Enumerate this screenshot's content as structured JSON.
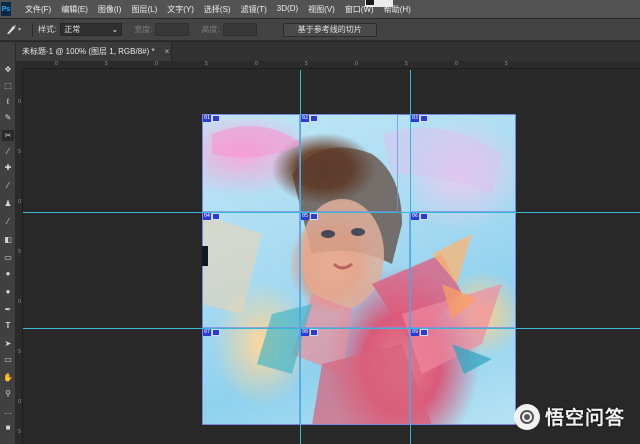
{
  "app": {
    "logo": "Ps"
  },
  "menu": {
    "items": [
      "文件(F)",
      "编辑(E)",
      "图像(I)",
      "图层(L)",
      "文字(Y)",
      "选择(S)",
      "滤镜(T)",
      "3D(D)",
      "视图(V)",
      "窗口(W)",
      "帮助(H)"
    ]
  },
  "options": {
    "tool_icon": "slice-tool-icon",
    "style_label": "样式:",
    "style_value": "正常",
    "width_label": "宽度:",
    "height_label": "高度:",
    "guides_button": "基于参考线的切片"
  },
  "document": {
    "tab_title": "未标题-1 @ 100% (图层 1, RGB/8#) *",
    "close": "×"
  },
  "ruler": {
    "top_labels": [
      "0",
      "5",
      "0",
      "5",
      "0",
      "5",
      "0",
      "5",
      "0",
      "5"
    ],
    "left_labels": [
      "0",
      "5",
      "0",
      "5",
      "0",
      "5",
      "0",
      "5"
    ]
  },
  "slices": [
    {
      "label": "01"
    },
    {
      "label": "02"
    },
    {
      "label": "03"
    },
    {
      "label": "04"
    },
    {
      "label": "05"
    },
    {
      "label": "06"
    },
    {
      "label": "07"
    },
    {
      "label": "08"
    },
    {
      "label": "09"
    }
  ],
  "watermark": {
    "text": "悟空问答",
    "icon": "wukong-logo-icon"
  },
  "colors": {
    "menubar": "#535353",
    "workspace": "#282828",
    "guide": "#39b6d6",
    "slice_tag": "#2a3bd6"
  }
}
